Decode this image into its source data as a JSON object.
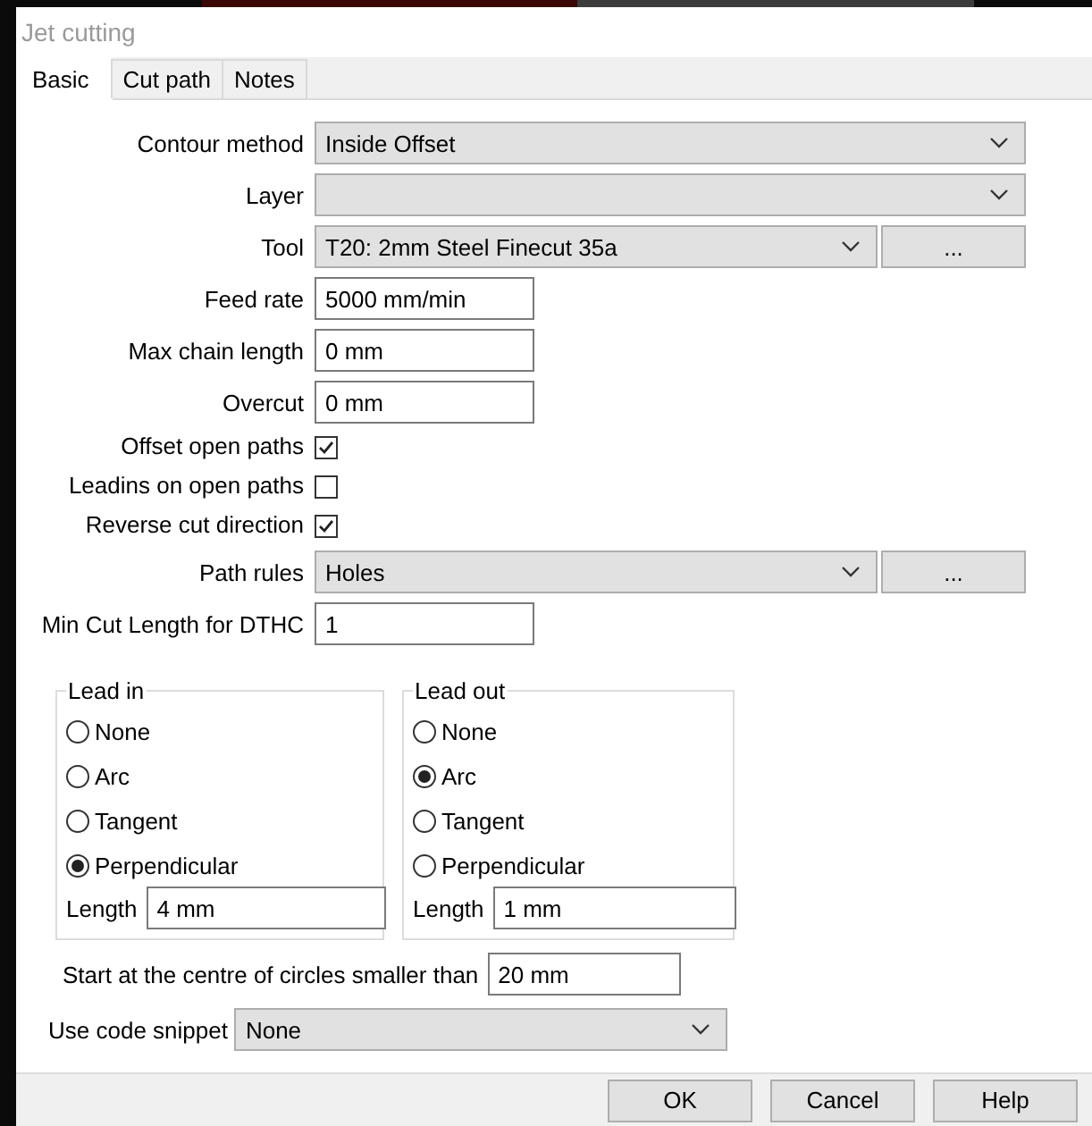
{
  "window": {
    "title": "Jet cutting"
  },
  "tabs": [
    {
      "label": "Basic",
      "selected": true
    },
    {
      "label": "Cut path",
      "selected": false
    },
    {
      "label": "Notes",
      "selected": false
    }
  ],
  "fields": [
    {
      "kind": "select",
      "label": "Contour method",
      "value": "Inside Offset"
    },
    {
      "kind": "select",
      "label": "Layer"
    },
    {
      "kind": "select",
      "label": "Tool",
      "value": "T20: 2mm Steel Finecut 35a",
      "button": "..."
    },
    {
      "kind": "text",
      "label": "Feed rate",
      "value": "5000 mm/min"
    },
    {
      "kind": "text",
      "label": "Max chain length",
      "value": "0 mm"
    },
    {
      "kind": "text",
      "label": "Overcut",
      "value": "0 mm"
    },
    {
      "kind": "checkbox",
      "label": "Offset open paths",
      "checked": true
    },
    {
      "kind": "checkbox",
      "label": "Leadins on open paths",
      "checked": false
    },
    {
      "kind": "checkbox",
      "label": "Reverse cut direction",
      "checked": true
    },
    {
      "kind": "select",
      "label": "Path rules",
      "value": "Holes",
      "button": "..."
    },
    {
      "kind": "text",
      "label": "Min Cut Length for DTHC",
      "value": "1"
    }
  ],
  "lead_in": {
    "title": "Lead in",
    "options": [
      {
        "label": "None",
        "selected": false
      },
      {
        "label": "Arc",
        "selected": false
      },
      {
        "label": "Tangent",
        "selected": false
      },
      {
        "label": "Perpendicular",
        "selected": true
      }
    ],
    "length_label": "Length",
    "length": "4 mm"
  },
  "lead_out": {
    "title": "Lead out",
    "options": [
      {
        "label": "None",
        "selected": false
      },
      {
        "label": "Arc",
        "selected": true
      },
      {
        "label": "Tangent",
        "selected": false
      },
      {
        "label": "Perpendicular",
        "selected": false
      }
    ],
    "length_label": "Length",
    "length": "1 mm"
  },
  "centre_start": {
    "label": "Start at the centre of circles smaller than",
    "value": "20 mm"
  },
  "code_snippet": {
    "label": "Use code snippet",
    "value": "None"
  },
  "buttons": [
    "OK",
    "Cancel",
    "Help"
  ]
}
